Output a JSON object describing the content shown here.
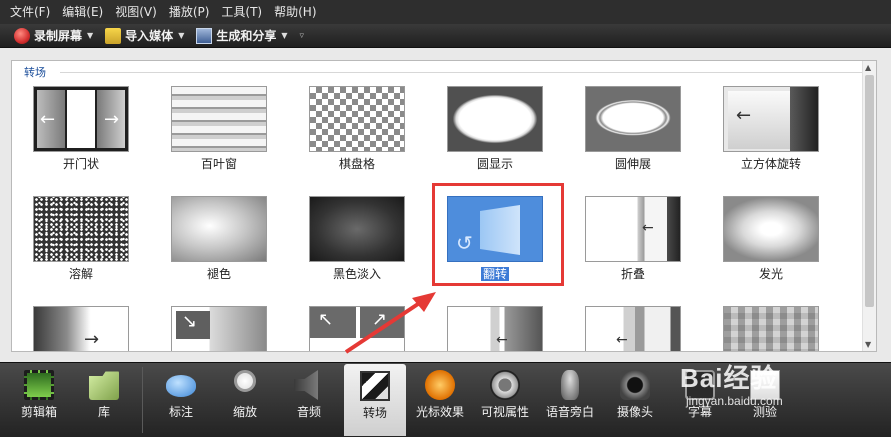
{
  "menu": [
    "文件(F)",
    "编辑(E)",
    "视图(V)",
    "播放(P)",
    "工具(T)",
    "帮助(H)"
  ],
  "toolbar": {
    "record": "录制屏幕",
    "import": "导入媒体",
    "produce": "生成和分享"
  },
  "panel": {
    "title": "转场",
    "tiles": [
      {
        "label": "开门状"
      },
      {
        "label": "百叶窗"
      },
      {
        "label": "棋盘格"
      },
      {
        "label": "圆显示"
      },
      {
        "label": "圆伸展"
      },
      {
        "label": "立方体旋转"
      },
      {
        "label": "溶解"
      },
      {
        "label": "褪色"
      },
      {
        "label": "黑色淡入"
      },
      {
        "label": "翻转"
      },
      {
        "label": "折叠"
      },
      {
        "label": "发光"
      }
    ],
    "selected": "翻转"
  },
  "tabs": [
    {
      "label": "剪辑箱",
      "icon": "film-strip-icon"
    },
    {
      "label": "库",
      "icon": "library-folder-icon"
    },
    {
      "label": "标注",
      "icon": "callout-bubble-icon"
    },
    {
      "label": "缩放",
      "icon": "zoom-magnifier-icon"
    },
    {
      "label": "音频",
      "icon": "speaker-icon"
    },
    {
      "label": "转场",
      "icon": "transition-icon"
    },
    {
      "label": "光标效果",
      "icon": "cursor-effect-icon"
    },
    {
      "label": "可视属性",
      "icon": "visual-properties-icon"
    },
    {
      "label": "语音旁白",
      "icon": "microphone-icon"
    },
    {
      "label": "摄像头",
      "icon": "camera-icon"
    },
    {
      "label": "字幕",
      "icon": "caption-icon"
    },
    {
      "label": "测验",
      "icon": "quiz-icon"
    }
  ],
  "active_tab": "转场",
  "watermark": {
    "brand": "Bai经验",
    "url": "jingyan.baidu.com"
  }
}
